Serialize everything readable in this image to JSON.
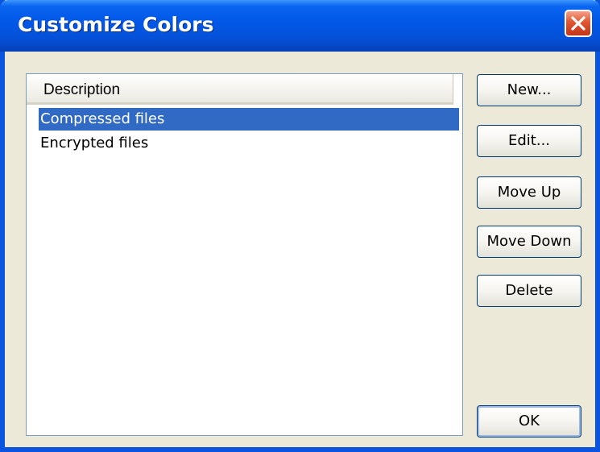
{
  "window": {
    "title": "Customize Colors"
  },
  "list": {
    "header": "Description",
    "items": [
      {
        "label": "Compressed files",
        "selected": true
      },
      {
        "label": "Encrypted files",
        "selected": false
      }
    ]
  },
  "buttons": {
    "new_label": "New...",
    "edit_label": "Edit...",
    "move_up_label": "Move Up",
    "move_down_label": "Move Down",
    "delete_label": "Delete",
    "ok_label": "OK"
  },
  "colors": {
    "titlebar": "#0258e8",
    "selection": "#316ac5",
    "dialog_bg": "#ece9d8",
    "close_button": "#e2552f"
  }
}
